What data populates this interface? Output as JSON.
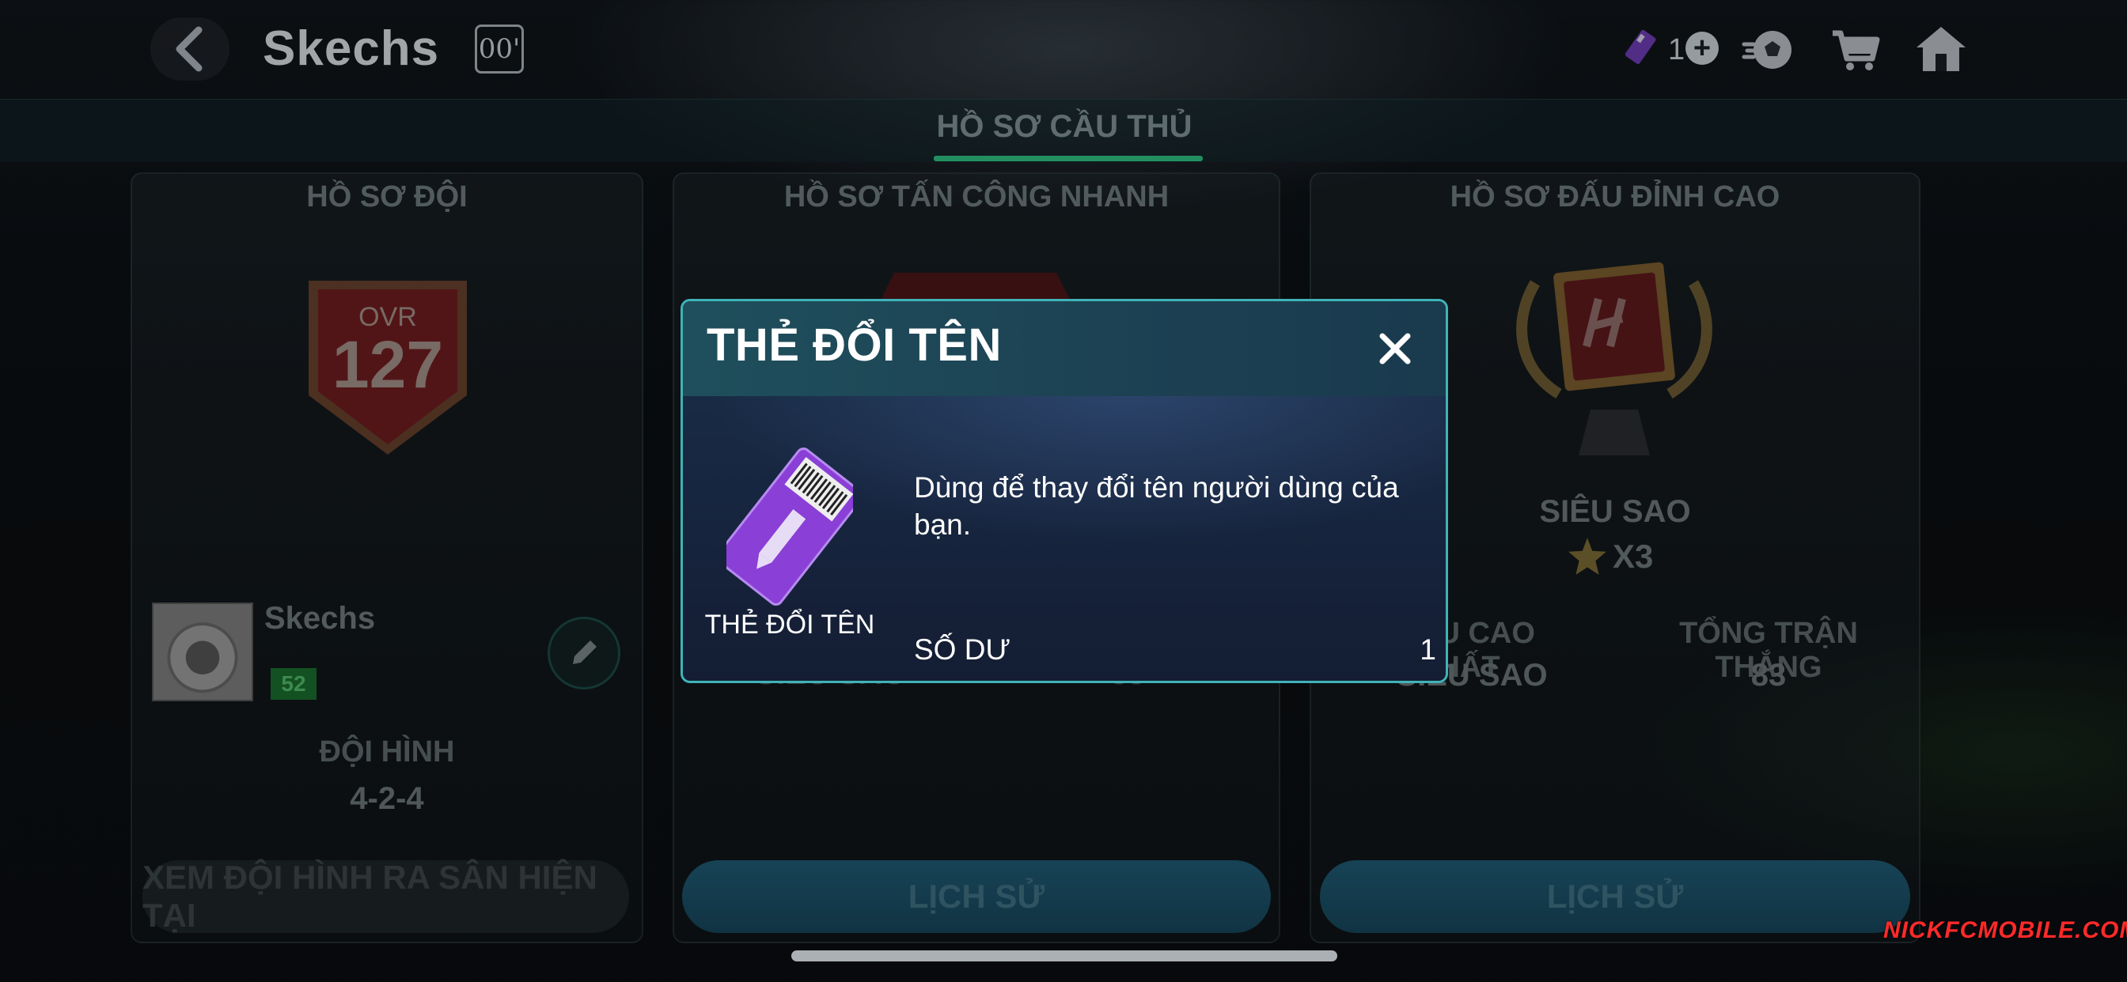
{
  "header": {
    "team_name": "Skechs",
    "name_badge": "00'",
    "ticket_count": "1"
  },
  "tab": {
    "label": "HỒ SƠ CẦU THỦ"
  },
  "panels": {
    "team": {
      "title": "HỒ SƠ ĐỘI",
      "ovr_label": "OVR",
      "ovr_value": "127",
      "player_name": "Skechs",
      "level": "52",
      "formation_label": "ĐỘI HÌNH",
      "formation_value": "4-2-4",
      "lineup_button": "XEM ĐỘI HÌNH RA SÂN HIỆN TẠI"
    },
    "quick_attack": {
      "title": "HỒ SƠ TẤN CÔNG NHANH",
      "partial_left": "SIÊU SAO",
      "partial_right": "83",
      "history_button": "LỊCH SỬ"
    },
    "top_match": {
      "title": "HỒ SƠ ĐẤU ĐỈNH CAO",
      "rank_label": "SIÊU SAO",
      "stars": "X3",
      "col1_label": "ẤU CAO NHẤT",
      "col1_value": "SIÊU SAO",
      "col2_label": "TỔNG TRẬN THẮNG",
      "col2_value": "83",
      "history_button": "LỊCH SỬ"
    }
  },
  "modal": {
    "title": "THẺ ĐỔI TÊN",
    "item_caption": "THẺ ĐỔI TÊN",
    "description": "Dùng để thay đổi tên người dùng của bạn.",
    "balance_label": "SỐ DƯ",
    "balance_value": "1"
  },
  "watermark": "NICKFCMOBILE.COM",
  "colors": {
    "accent_green": "#2fbf82",
    "modal_border": "#3fb3b8",
    "ticket_purple": "#8a3fd6"
  }
}
